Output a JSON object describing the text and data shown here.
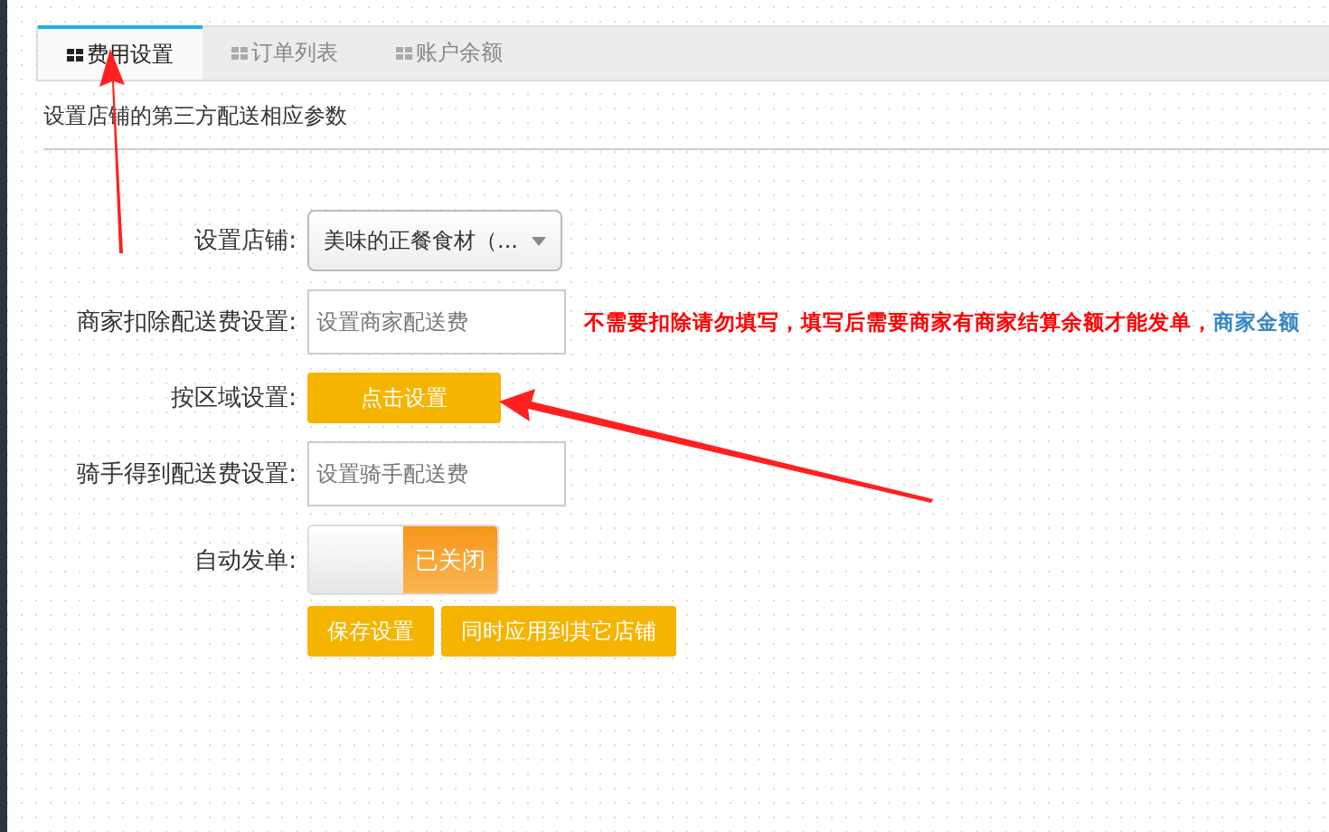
{
  "tabs": [
    {
      "label": "费用设置",
      "selected": true
    },
    {
      "label": "订单列表",
      "selected": false
    },
    {
      "label": "账户余额",
      "selected": false
    }
  ],
  "description": "设置店铺的第三方配送相应参数",
  "form": [
    {
      "kind": "select",
      "label": "设置店铺:",
      "value": "美味的正餐食材（..."
    },
    {
      "kind": "input",
      "label": "商家扣除配送费设置:",
      "placeholder": "设置商家配送费",
      "note": "不需要扣除请勿填写，填写后需要商家有商家结算余额才能发单，",
      "note_link": "商家金额"
    },
    {
      "kind": "button",
      "label": "按区域设置:",
      "button": "点击设置"
    },
    {
      "kind": "input",
      "label": "骑手得到配送费设置:",
      "placeholder": "设置骑手配送费"
    },
    {
      "kind": "toggle",
      "label": "自动发单:",
      "on": false,
      "state_text": "已关闭"
    }
  ],
  "actions": [
    "保存设置",
    "同时应用到其它店铺"
  ]
}
